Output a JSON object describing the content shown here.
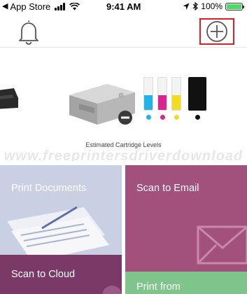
{
  "status_bar": {
    "back_label": "◀",
    "carrier": "App Store",
    "time": "9:41 AM",
    "battery_percent": "100%",
    "battery_level": 1.0,
    "icons": [
      "signal-icon",
      "wifi-icon",
      "location-icon",
      "bluetooth-icon",
      "battery-icon"
    ]
  },
  "navbar": {
    "left_icon": "bell-icon",
    "right_icon": "add-circle-icon",
    "highlight_color": "#e02020"
  },
  "printer": {
    "estimated_label": "Estimated Cartridge Levels",
    "watermark": "www.freeprintersdriverdownload",
    "cartridges": [
      {
        "name": "cyan",
        "color": "#22b3e6",
        "level": 0.45
      },
      {
        "name": "magenta",
        "color": "#d6278f",
        "level": 0.45
      },
      {
        "name": "yellow",
        "color": "#f2dc1b",
        "level": 0.45
      },
      {
        "name": "black",
        "color": "#111111",
        "level": 1.0
      }
    ]
  },
  "tiles": {
    "print_documents": {
      "label": "Print Documents",
      "color": "#c9d0e3"
    },
    "scan_to_email": {
      "label": "Scan to Email",
      "color": "#a2507c"
    },
    "scan_to_cloud": {
      "label": "Scan to Cloud",
      "color": "#7b3967"
    },
    "print_from": {
      "label": "Print from",
      "color": "#7fc48a"
    }
  }
}
